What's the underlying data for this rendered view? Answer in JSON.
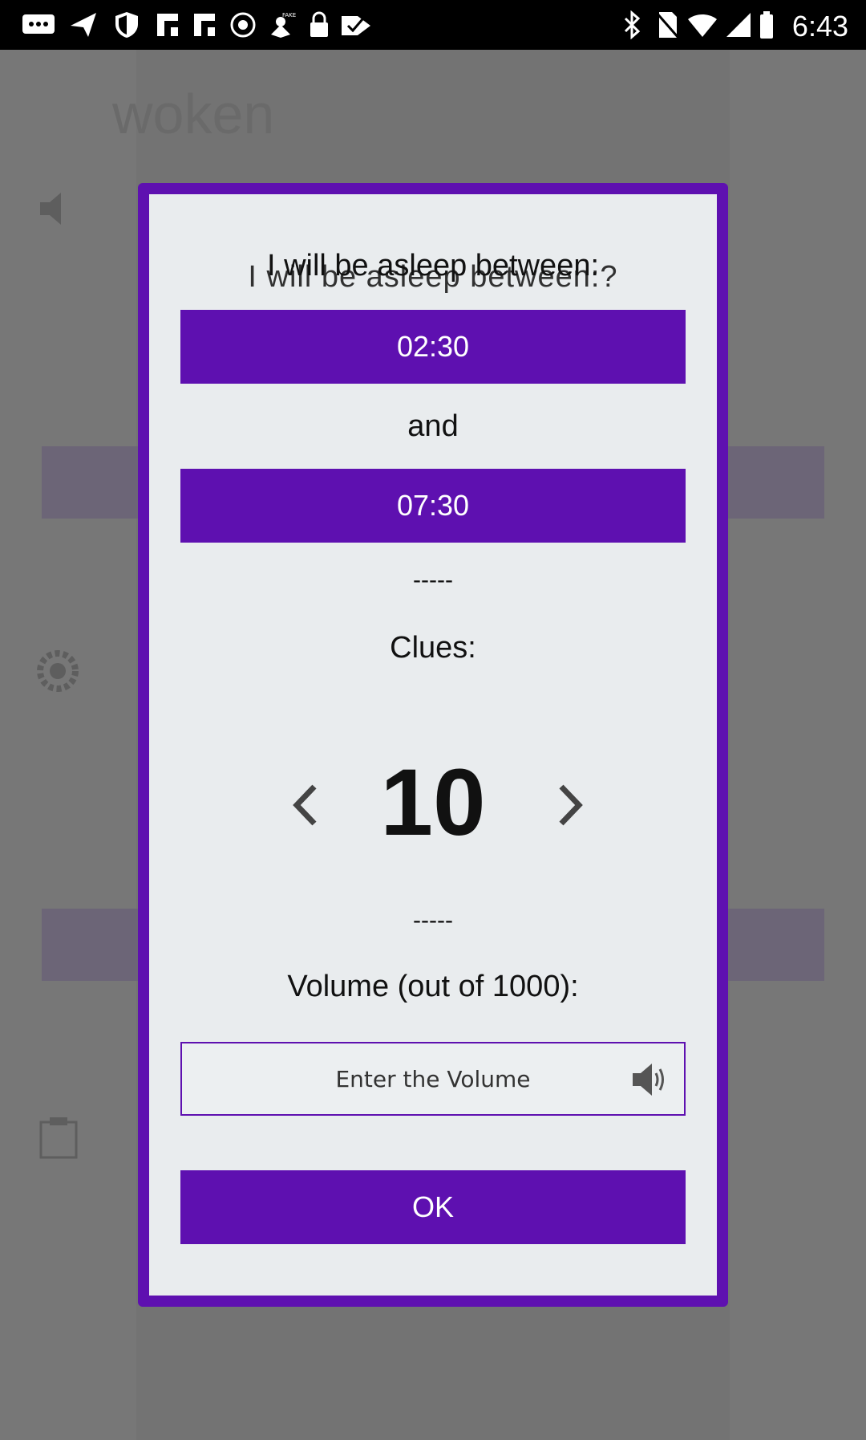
{
  "status_bar": {
    "time": "6:43",
    "icons": [
      "chat-icon",
      "send-icon",
      "shield-icon",
      "flipboard-icon",
      "flipboard-icon",
      "target-icon",
      "fake-gps-icon",
      "lock-icon",
      "checkmark-icon",
      "bluetooth-icon",
      "no-sim-icon",
      "wifi-icon",
      "cell-signal-icon",
      "battery-icon"
    ]
  },
  "background_app": {
    "title": "woken"
  },
  "dialog": {
    "title": "I will be asleep between:",
    "title_echo": "I will be asleep between:?",
    "start_time": "02:30",
    "and_label": "and",
    "end_time": "07:30",
    "separator": "-----",
    "clues_label": "Clues:",
    "clues_value": "10",
    "volume_label": "Volume (out of 1000):",
    "volume_placeholder": "Enter the Volume",
    "volume_value": "",
    "ok_label": "OK"
  },
  "colors": {
    "accent": "#5e10b0",
    "dialog_bg": "#e9ecee",
    "overlay": "#6b6b6b"
  }
}
